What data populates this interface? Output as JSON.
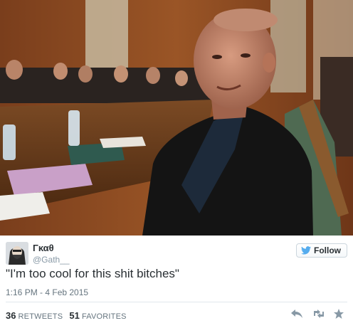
{
  "tweet": {
    "display_name": "Γκαθ",
    "handle": "@Gath__",
    "text": "\"I'm too cool for this shit bitches\"",
    "timestamp": "1:16 PM - 4 Feb 2015",
    "follow_label": "Follow",
    "retweets_count": "36",
    "retweets_label": "RETWEETS",
    "favorites_count": "51",
    "favorites_label": "FAVORITES"
  },
  "icons": {
    "twitter_bird": "bird-icon",
    "reply": "reply-icon",
    "retweet": "retweet-icon",
    "favorite": "star-icon"
  },
  "colors": {
    "twitter_blue": "#55acee",
    "text": "#292f33",
    "muted": "#8899a6",
    "icon_gray": "#8899a6"
  }
}
